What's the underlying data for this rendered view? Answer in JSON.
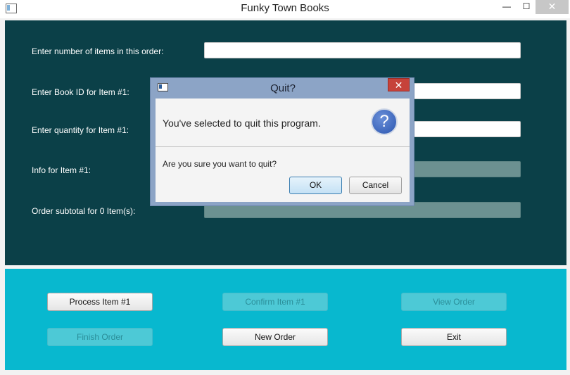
{
  "window": {
    "title": "Funky Town Books",
    "min": "—",
    "max": "☐",
    "close": "✕"
  },
  "form": {
    "labels": {
      "num_items": "Enter number of items in this order:",
      "book_id": "Enter Book ID for Item #1:",
      "quantity": "Enter quantity for Item #1:",
      "info": "Info for Item #1:",
      "subtotal": "Order subtotal for 0 Item(s):"
    },
    "values": {
      "num_items": "",
      "book_id": "",
      "quantity": "",
      "info": "",
      "subtotal": ""
    }
  },
  "buttons": {
    "process": "Process Item #1",
    "confirm": "Confirm Item #1",
    "view": "View Order",
    "finish": "Finish Order",
    "new": "New Order",
    "exit": "Exit"
  },
  "dialog": {
    "title": "Quit?",
    "close": "✕",
    "header": "You've selected to quit this program.",
    "icon_glyph": "?",
    "message": "Are you sure you want to quit?",
    "ok": "OK",
    "cancel": "Cancel"
  },
  "colors": {
    "top_panel": "#0b4048",
    "bottom_panel": "#08b8cf",
    "dialog_frame": "#8ca4c6"
  }
}
